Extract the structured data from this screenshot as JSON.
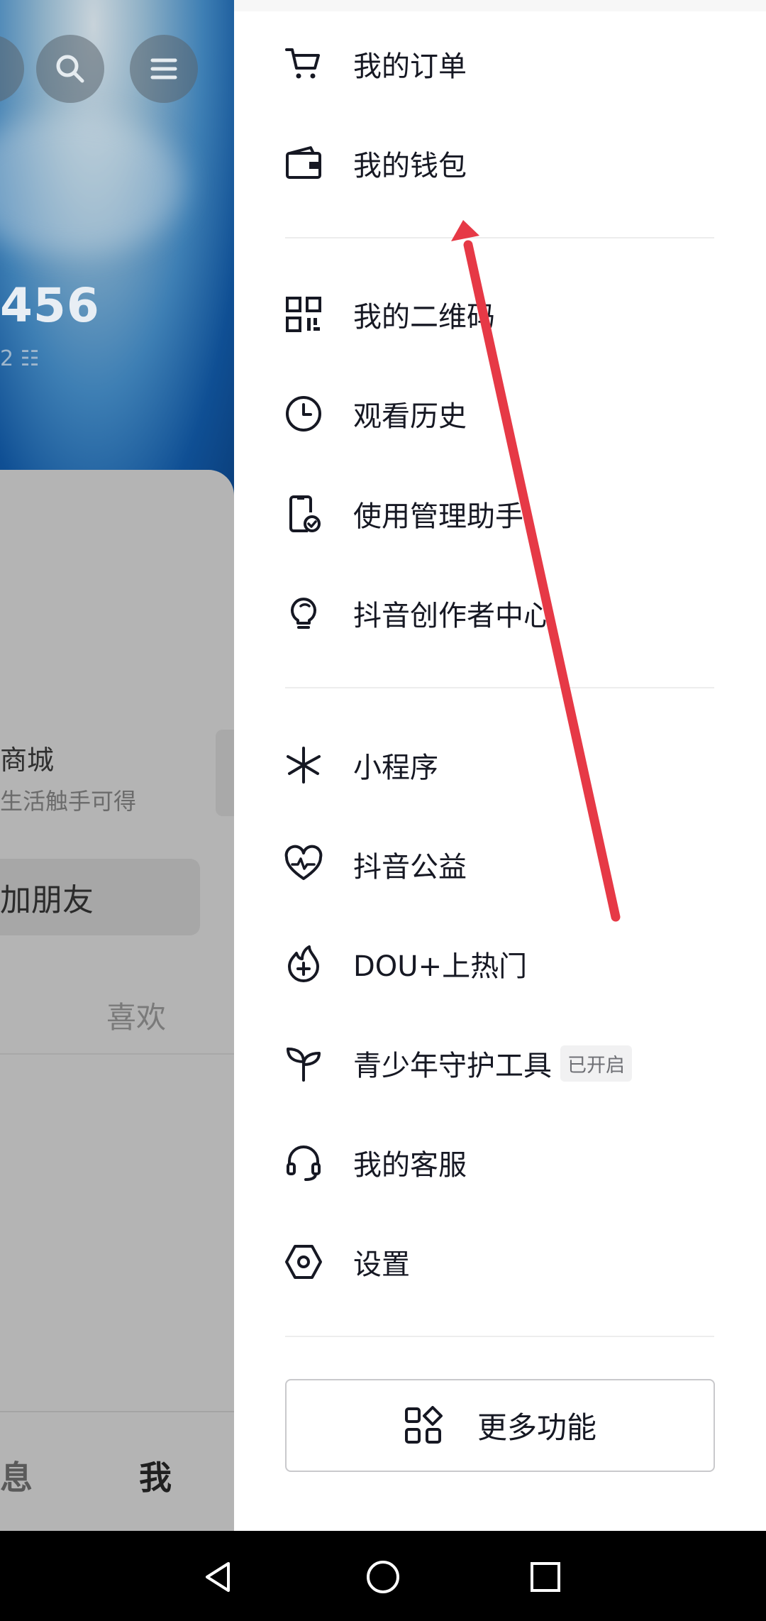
{
  "background": {
    "follower_count": "456",
    "id_fragment": "2 ☷",
    "mall_title": "商城",
    "mall_subtitle": "生活触手可得",
    "add_friend": "加朋友",
    "like_tab": "喜欢",
    "nav_message": "息",
    "nav_me": "我"
  },
  "drawer": {
    "group1": [
      {
        "label": "我的订单",
        "icon": "cart-icon"
      },
      {
        "label": "我的钱包",
        "icon": "wallet-icon"
      }
    ],
    "group2": [
      {
        "label": "我的二维码",
        "icon": "qr-code-icon"
      },
      {
        "label": "观看历史",
        "icon": "clock-icon"
      },
      {
        "label": "使用管理助手",
        "icon": "phone-check-icon"
      },
      {
        "label": "抖音创作者中心",
        "icon": "lightbulb-icon"
      }
    ],
    "group3": [
      {
        "label": "小程序",
        "icon": "mini-program-icon"
      },
      {
        "label": "抖音公益",
        "icon": "heart-charity-icon"
      },
      {
        "label": "DOU+上热门",
        "icon": "flame-plus-icon"
      },
      {
        "label": "青少年守护工具",
        "icon": "sprout-icon",
        "badge": "已开启"
      },
      {
        "label": "我的客服",
        "icon": "headset-icon"
      },
      {
        "label": "设置",
        "icon": "settings-hexagon-icon"
      }
    ],
    "more_button": "更多功能"
  },
  "annotation": {
    "arrow_color": "#e63946"
  },
  "system_nav": [
    "back-icon",
    "home-icon",
    "recents-icon"
  ]
}
